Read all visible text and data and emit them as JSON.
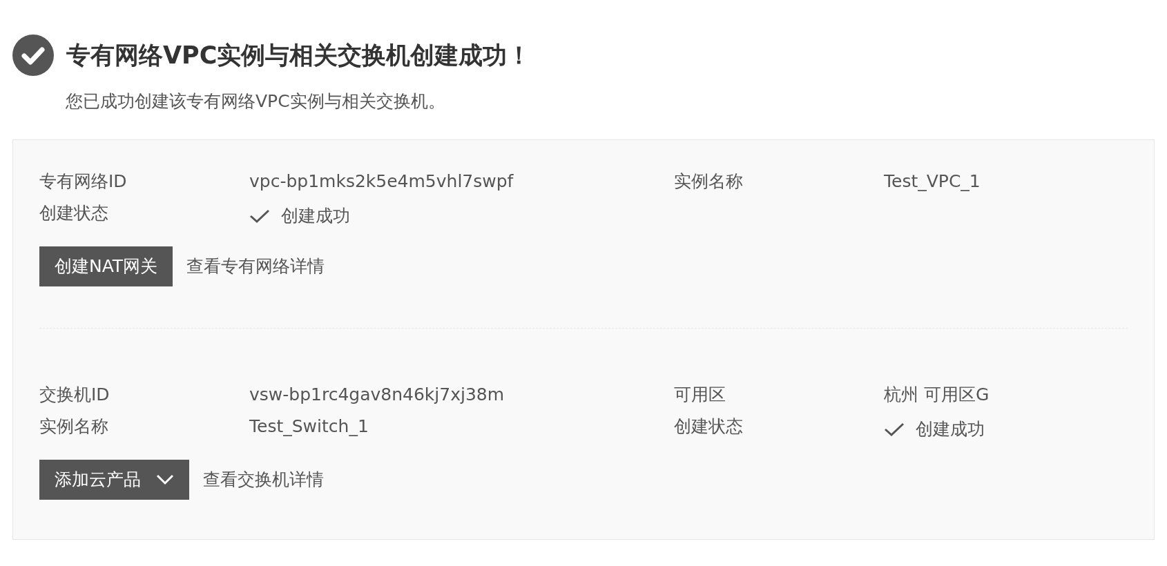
{
  "header": {
    "title": "专有网络VPC实例与相关交换机创建成功！",
    "subtitle": "您已成功创建该专有网络VPC实例与相关交换机。"
  },
  "sections": [
    {
      "fields": [
        {
          "kind": "text",
          "label": "专有网络ID",
          "value": "vpc-bp1mks2k5e4m5vhl7swpf"
        },
        {
          "kind": "text",
          "label": "实例名称",
          "value": "Test_VPC_1"
        },
        {
          "kind": "status",
          "label": "创建状态",
          "value": "创建成功"
        }
      ],
      "button": {
        "label": "创建NAT网关",
        "dropdown": false
      },
      "link": "查看专有网络详情"
    },
    {
      "fields": [
        {
          "kind": "text",
          "label": "交换机ID",
          "value": "vsw-bp1rc4gav8n46kj7xj38m"
        },
        {
          "kind": "text",
          "label": "可用区",
          "value": "杭州 可用区G"
        },
        {
          "kind": "text",
          "label": "实例名称",
          "value": "Test_Switch_1"
        },
        {
          "kind": "status",
          "label": "创建状态",
          "value": "创建成功"
        }
      ],
      "button": {
        "label": "添加云产品",
        "dropdown": true
      },
      "link": "查看交换机详情"
    }
  ]
}
